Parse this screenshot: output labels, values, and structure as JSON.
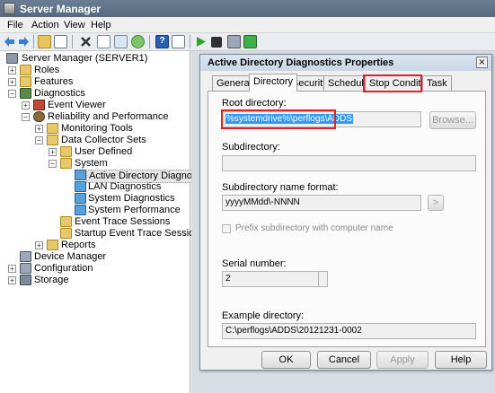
{
  "window": {
    "title": "Server Manager"
  },
  "menu": [
    "File",
    "Action",
    "View",
    "Help"
  ],
  "toolbar_icons": [
    "back-arrow-icon",
    "forward-arrow-icon",
    "up-folder-icon",
    "show-hide-tree-icon",
    "delete-icon",
    "properties-icon",
    "export-icon",
    "refresh-icon",
    "help-icon",
    "console-icon",
    "start-icon",
    "stop-icon",
    "save-template-icon",
    "report-icon"
  ],
  "tree": [
    {
      "label": "Server Manager (SERVER1)"
    },
    {
      "label": "Roles"
    },
    {
      "label": "Features"
    },
    {
      "label": "Diagnostics"
    },
    {
      "label": "Event Viewer"
    },
    {
      "label": "Reliability and Performance"
    },
    {
      "label": "Monitoring Tools"
    },
    {
      "label": "Data Collector Sets"
    },
    {
      "label": "User Defined"
    },
    {
      "label": "System"
    },
    {
      "label": "Active Directory Diagnostics"
    },
    {
      "label": "LAN Diagnostics"
    },
    {
      "label": "System Diagnostics"
    },
    {
      "label": "System Performance"
    },
    {
      "label": "Event Trace Sessions"
    },
    {
      "label": "Startup Event Trace Sessions"
    },
    {
      "label": "Reports"
    },
    {
      "label": "Device Manager"
    },
    {
      "label": "Configuration"
    },
    {
      "label": "Storage"
    }
  ],
  "dialog": {
    "title": "Active Directory Diagnostics Properties",
    "close": "×",
    "tabs": [
      "General",
      "Directory",
      "Security",
      "Schedule",
      "Stop Condition",
      "Task"
    ],
    "root_label": "Root directory:",
    "root_value": "%systemdrive%\\perflogs\\ADDS",
    "browse": "Browse...",
    "sub_label": "Subdirectory:",
    "sub_value": "",
    "fmt_label": "Subdirectory name format:",
    "fmt_value": "yyyyMMdd\\-NNNN",
    "fmt_btn": ">",
    "prefix_label": "Prefix subdirectory with computer name",
    "serial_label": "Serial number:",
    "serial_value": "2",
    "example_label": "Example directory:",
    "example_value": "C:\\perflogs\\ADDS\\20121231-0002",
    "ok": "OK",
    "cancel": "Cancel",
    "apply": "Apply",
    "help": "Help"
  },
  "colors": {
    "selection": "#3399ff",
    "annotation": "#e0202a",
    "title_bar": "#56697f"
  }
}
